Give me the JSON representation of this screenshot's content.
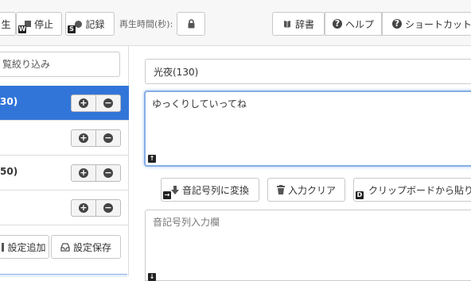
{
  "toolbar": {
    "play_label": "生",
    "stop_label": "停止",
    "stop_key": "W",
    "record_label": "記録",
    "record_key": "S",
    "playtime_label": "再生時間(秒):",
    "dictionary_label": "辞書",
    "help_label": "ヘルプ",
    "shortcut_label": "ショートカット"
  },
  "sidebar": {
    "filter_placeholder": "覧絞り込み",
    "items": [
      {
        "label": "30)",
        "active": true
      },
      {
        "label": "",
        "active": false
      },
      {
        "label": "50)",
        "active": false
      },
      {
        "label": "",
        "active": false
      }
    ],
    "add_setting_label": "設定追加",
    "save_setting_label": "設定保存"
  },
  "main": {
    "character_value": "光夜(130)",
    "text_value": "ゆっくりしていってね",
    "text_key": "↑",
    "convert_label": "音記号列に変換",
    "convert_key": "→",
    "clear_label": "入力クリア",
    "clipboard_label": "クリップボードから貼り付け",
    "clipboard_key": "D",
    "kana_placeholder": "音記号列入力欄",
    "kana_key": "↓"
  },
  "colors": {
    "active_row": "#3275d9",
    "focus_border": "#86aee6"
  }
}
